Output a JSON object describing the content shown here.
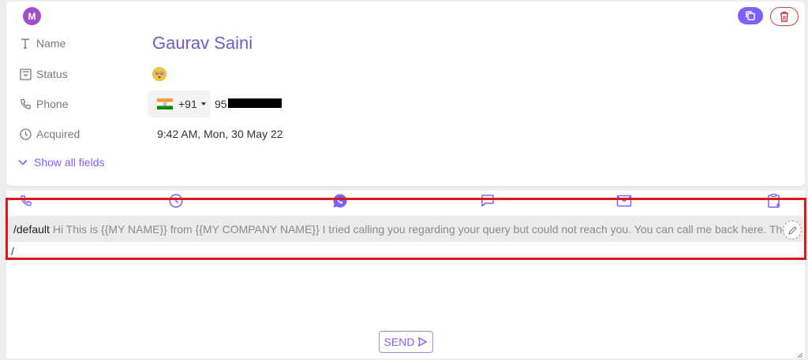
{
  "header": {
    "avatar_letter": "M"
  },
  "fields": {
    "name_label": "Name",
    "name_value": "Gaurav Saini",
    "status_label": "Status",
    "phone_label": "Phone",
    "phone_country_code": "+91",
    "phone_number_visible": "95",
    "acquired_label": "Acquired",
    "acquired_value": "9:42 AM, Mon, 30 May 22",
    "show_all_label": "Show all fields"
  },
  "icons": {
    "copy": "copy-icon",
    "delete": "trash-icon",
    "status_emoji": "worried-face-emoji",
    "flag": "india-flag-icon",
    "colors": {
      "accent": "#7b61ff",
      "name": "#6e5cc9",
      "delete": "#c94040",
      "highlight": "#e0161e"
    }
  },
  "message": {
    "template_command": "/default",
    "template_body": " Hi This is {{MY NAME}} from {{MY COMPANY NAME}} I tried calling you regarding your query but could not reach you. You can call me back here. Tha",
    "input_value": "/",
    "send_label": "SEND"
  }
}
